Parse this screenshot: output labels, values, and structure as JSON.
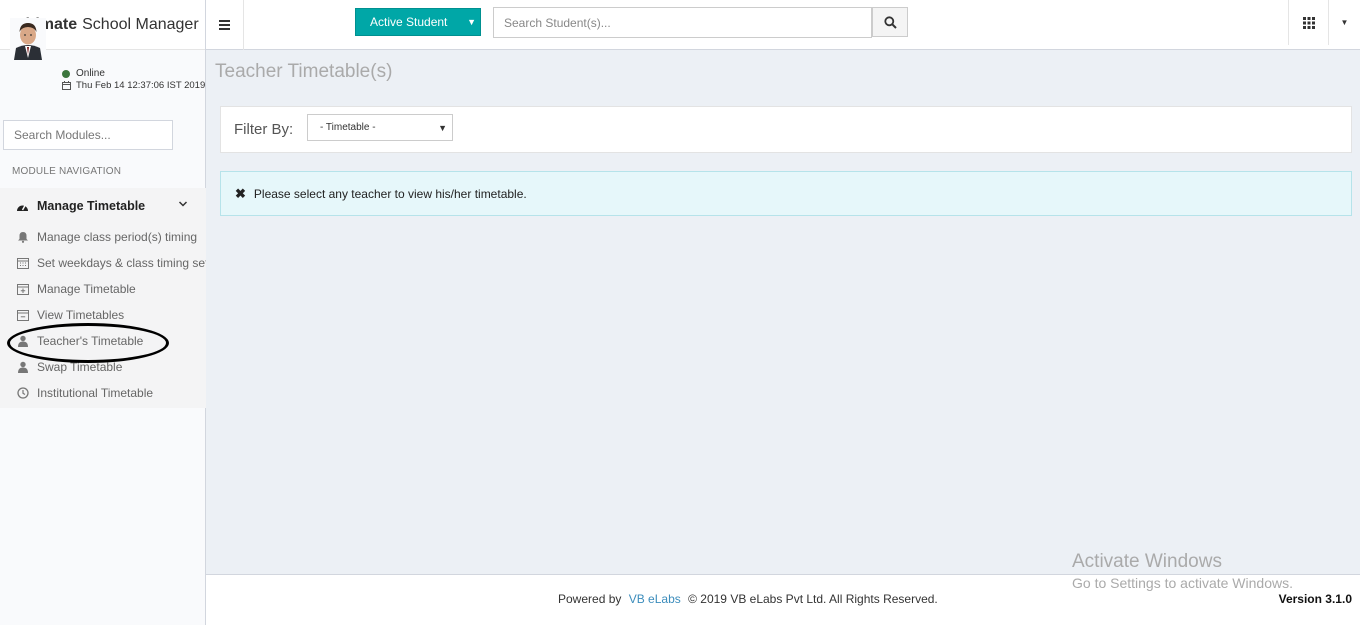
{
  "app": {
    "brand_bold": "Ultimate",
    "brand_rest": "School Manager"
  },
  "user": {
    "status": "Online",
    "datetime": "Thu Feb 14 12:37:06 IST 2019"
  },
  "sidebar": {
    "search_placeholder": "Search Modules...",
    "nav_header": "MODULE NAVIGATION",
    "menu_title": "Manage Timetable",
    "items": [
      {
        "label": "Manage class period(s) timing",
        "icon": "bell-icon"
      },
      {
        "label": "Set weekdays & class timing sets",
        "icon": "calendar-icon"
      },
      {
        "label": "Manage Timetable",
        "icon": "calendar-plus-icon"
      },
      {
        "label": "View Timetables",
        "icon": "calendar-minus-icon"
      },
      {
        "label": "Teacher's Timetable",
        "icon": "user-icon"
      },
      {
        "label": "Swap Timetable",
        "icon": "user-icon"
      },
      {
        "label": "Institutional Timetable",
        "icon": "clock-icon"
      }
    ]
  },
  "topbar": {
    "active_student_label": "Active Student",
    "search_placeholder": "Search Student(s)..."
  },
  "content": {
    "page_title": "Teacher Timetable(s)",
    "filter_label": "Filter By:",
    "filter_value": "- Timetable -",
    "alert_text": "Please select any teacher to view his/her timetable."
  },
  "footer": {
    "powered_by": "Powered by",
    "company_link": "VB eLabs",
    "copyright": "© 2019 VB eLabs Pvt Ltd. All Rights Reserved.",
    "version": "Version 3.1.0"
  },
  "watermark": {
    "title": "Activate Windows",
    "subtitle": "Go to Settings to activate Windows."
  },
  "colors": {
    "accent": "#00a7a7",
    "link": "#3c8dbc",
    "online": "#3c763d",
    "alert_bg": "#e6f7fa"
  }
}
